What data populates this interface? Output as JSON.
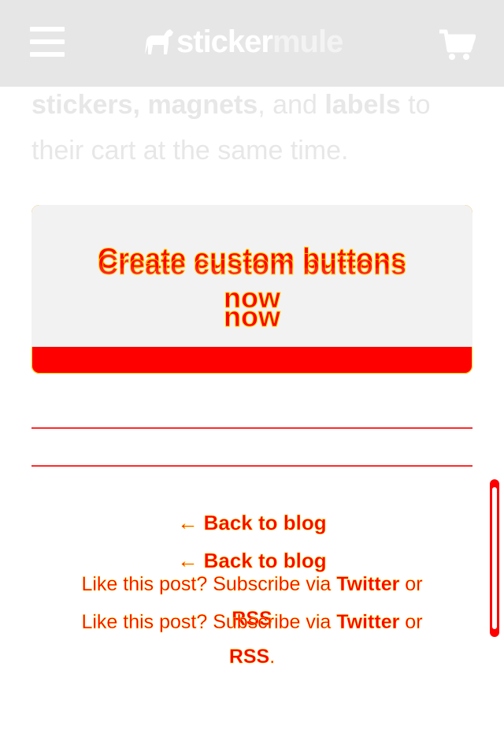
{
  "header": {
    "logo_word1": "sticker",
    "logo_word2": "mule"
  },
  "intro": {
    "prefix_bold": "stickers, magnets",
    "middle": ", and ",
    "bold2": "labels",
    "suffix": " to their cart at the same time."
  },
  "cta": {
    "line1": "Create custom buttons",
    "line2": "now"
  },
  "footer": {
    "back_link": "← Back to blog",
    "subscribe_prefix": "Like this post? Subscribe via ",
    "twitter": "Twitter",
    "or": " or",
    "rss": "RSS",
    "period": "."
  },
  "colors": {
    "header_bg": "#e6e6e6",
    "accent": "#ff0000",
    "outline": "#ffd700",
    "intro_text": "#e7e7e7"
  }
}
